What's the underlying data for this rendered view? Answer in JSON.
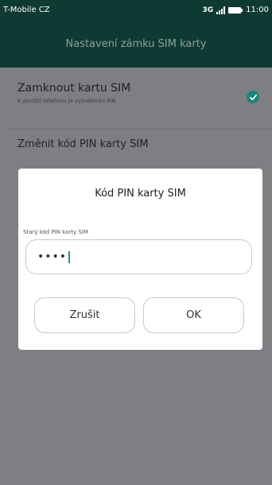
{
  "status_bar": {
    "carrier": "T-Mobile CZ",
    "network": "3G",
    "time": "11:00",
    "icons": [
      "signal-icon",
      "battery-icon"
    ]
  },
  "header": {
    "title": "Nastavení zámku SIM karty"
  },
  "settings": {
    "lock_sim": {
      "label": "Zamknout kartu SIM",
      "sublabel": "K použití telefonu je vyžadován PIN",
      "checked": true
    },
    "change_pin": {
      "label": "Změnit kód PIN karty SIM"
    }
  },
  "dialog": {
    "title": "Kód PIN karty SIM",
    "field_label": "Starý kód PIN karty SIM",
    "pin_masked": "••••",
    "cancel_label": "Zrušit",
    "ok_label": "OK"
  },
  "colors": {
    "accent": "#1d8577",
    "header_bg": "#0f3a33",
    "dim_overlay_bg": "#7d7f82"
  }
}
